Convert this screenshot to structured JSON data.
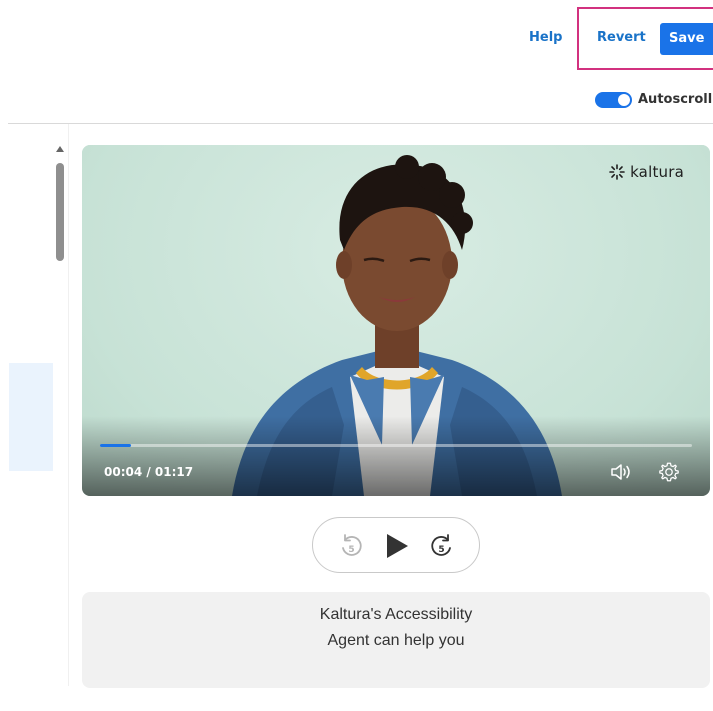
{
  "header": {
    "help_label": "Help",
    "revert_label": "Revert",
    "save_label": "Save",
    "autoscroll_label": "Autoscroll",
    "autoscroll_on": true,
    "accent_color": "#1a73e8",
    "highlight_color": "#d2317f"
  },
  "player": {
    "brand": "kaltura",
    "time_display": "00:04 / 01:17",
    "current_time": "00:04",
    "duration": "01:17",
    "progress_fraction": 0.052,
    "icons": [
      "kaltura-logo-icon",
      "volume-icon",
      "settings-gear-icon"
    ]
  },
  "controls": {
    "icons": [
      "rewind-5-icon",
      "play-icon",
      "forward-5-icon"
    ],
    "rewind_seconds": "5",
    "forward_seconds": "5"
  },
  "agent": {
    "line1": "Kaltura's Accessibility",
    "line2": "Agent can help you"
  }
}
